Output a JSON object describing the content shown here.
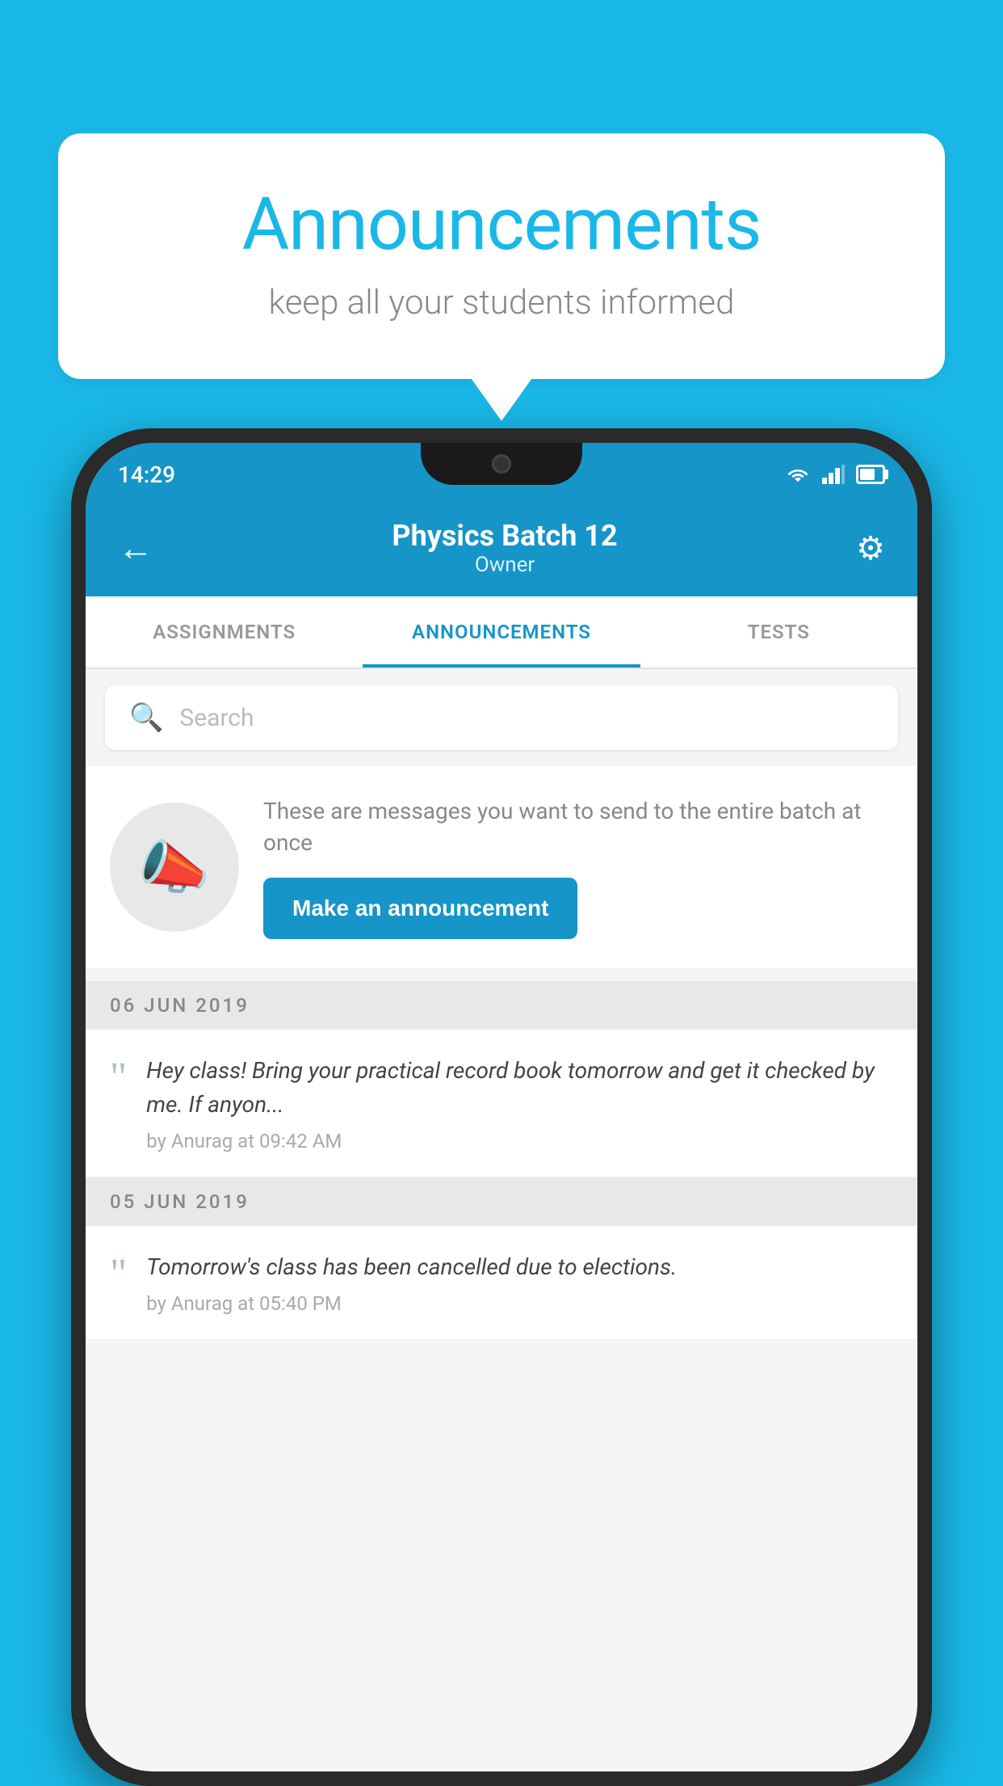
{
  "page": {
    "background_color": "#1ab8e8"
  },
  "speech_bubble": {
    "title": "Announcements",
    "subtitle": "keep all your students informed"
  },
  "phone": {
    "status_bar": {
      "time": "14:29"
    },
    "header": {
      "title": "Physics Batch 12",
      "subtitle": "Owner",
      "back_label": "←",
      "gear_label": "⚙"
    },
    "tabs": [
      {
        "label": "ASSIGNMENTS",
        "active": false
      },
      {
        "label": "ANNOUNCEMENTS",
        "active": true
      },
      {
        "label": "TESTS",
        "active": false
      }
    ],
    "search": {
      "placeholder": "Search"
    },
    "promo": {
      "description": "These are messages you want to send to the entire batch at once",
      "button_label": "Make an announcement"
    },
    "announcements": [
      {
        "date": "06  JUN  2019",
        "text": "Hey class! Bring your practical record book tomorrow and get it checked by me. If anyon...",
        "meta": "by Anurag at 09:42 AM"
      },
      {
        "date": "05  JUN  2019",
        "text": "Tomorrow's class has been cancelled due to elections.",
        "meta": "by Anurag at 05:40 PM"
      }
    ]
  }
}
